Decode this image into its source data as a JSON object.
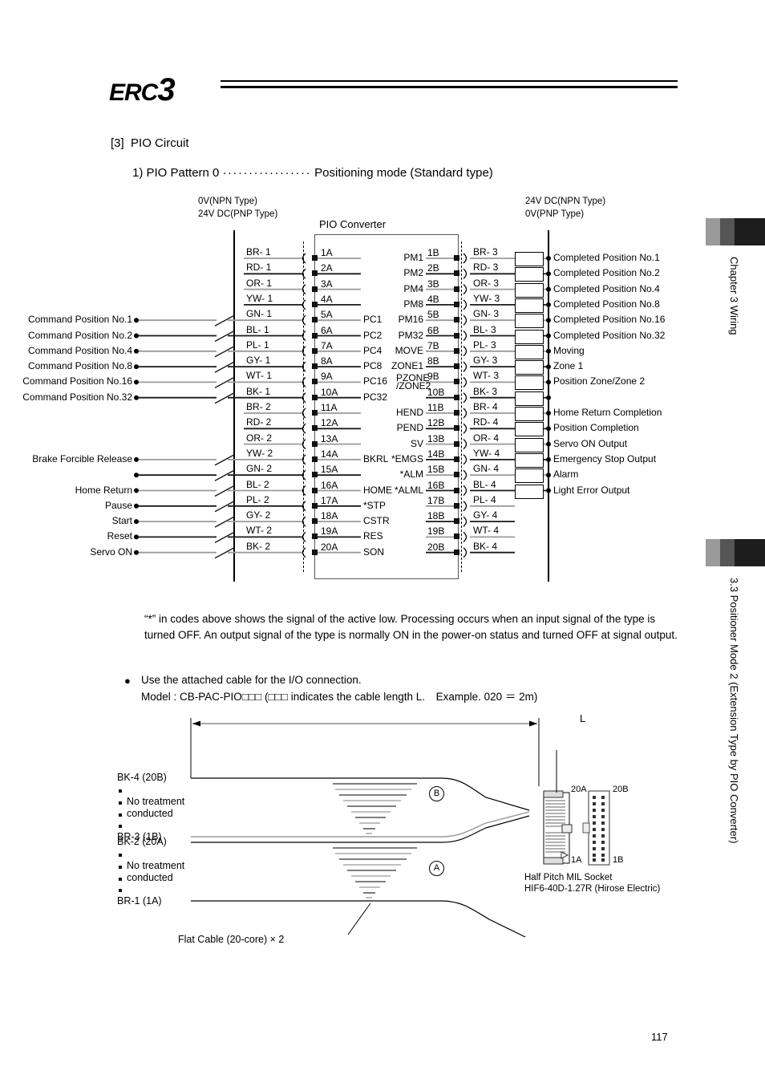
{
  "document": {
    "logo_erc": "ERC",
    "logo_3": "3",
    "page_number": "117"
  },
  "section": {
    "number": "[3]",
    "title": "PIO Circuit",
    "subsection_prefix": "1) PIO Pattern 0",
    "dot_leader": "·················",
    "subsection_suffix": "Positioning mode (Standard type)"
  },
  "sidebar": {
    "chapter_tab": "Chapter 3 Wiring",
    "section_tab": "3.3 Positioner Mode 2 (Extension Type by PIO Converter)"
  },
  "diagram": {
    "converter_title": "PIO Converter",
    "left_supply_line1": "0V(NPN Type)",
    "left_supply_line2": "24V DC(PNP Type)",
    "right_supply_line1": "24V DC(NPN Type)",
    "right_supply_line2": "0V(PNP Type)",
    "input_rows": [
      {
        "pin": "1A",
        "wire": "BR- 1",
        "signal": "",
        "io": "",
        "switch": false,
        "gray": true
      },
      {
        "pin": "2A",
        "wire": "RD- 1",
        "signal": "",
        "io": "",
        "switch": false,
        "gray": false
      },
      {
        "pin": "3A",
        "wire": "OR- 1",
        "signal": "",
        "io": "",
        "switch": false,
        "gray": true
      },
      {
        "pin": "4A",
        "wire": "YW- 1",
        "signal": "",
        "io": "",
        "switch": false,
        "gray": false
      },
      {
        "pin": "5A",
        "wire": "GN- 1",
        "signal": "PC1",
        "io": "Command Position No.1",
        "switch": true,
        "gray": true
      },
      {
        "pin": "6A",
        "wire": "BL- 1",
        "signal": "PC2",
        "io": "Command Position No.2",
        "switch": true,
        "gray": false
      },
      {
        "pin": "7A",
        "wire": "PL- 1",
        "signal": "PC4",
        "io": "Command Position No.4",
        "switch": true,
        "gray": true
      },
      {
        "pin": "8A",
        "wire": "GY- 1",
        "signal": "PC8",
        "io": "Command Position No.8",
        "switch": true,
        "gray": false
      },
      {
        "pin": "9A",
        "wire": "WT- 1",
        "signal": "PC16",
        "io": "Command Position No.16",
        "switch": true,
        "gray": true
      },
      {
        "pin": "10A",
        "wire": "BK- 1",
        "signal": "PC32",
        "io": "Command Position No.32",
        "switch": true,
        "gray": false
      },
      {
        "pin": "11A",
        "wire": "BR- 2",
        "signal": "",
        "io": "",
        "switch": false,
        "gray": true
      },
      {
        "pin": "12A",
        "wire": "RD- 2",
        "signal": "",
        "io": "",
        "switch": false,
        "gray": false
      },
      {
        "pin": "13A",
        "wire": "OR- 2",
        "signal": "",
        "io": "",
        "switch": false,
        "gray": true
      },
      {
        "pin": "14A",
        "wire": "YW- 2",
        "signal": "BKRL",
        "io": "Brake Forcible Release",
        "switch": true,
        "gray": true
      },
      {
        "pin": "15A",
        "wire": "GN- 2",
        "signal": "",
        "io": "",
        "switch": true,
        "gray": false
      },
      {
        "pin": "16A",
        "wire": "BL- 2",
        "signal": "HOME",
        "io": "Home Return",
        "switch": true,
        "gray": true
      },
      {
        "pin": "17A",
        "wire": "PL- 2",
        "signal": "*STP",
        "io": "Pause",
        "switch": true,
        "gray": false
      },
      {
        "pin": "18A",
        "wire": "GY- 2",
        "signal": "CSTR",
        "io": "Start",
        "switch": true,
        "gray": true
      },
      {
        "pin": "19A",
        "wire": "WT- 2",
        "signal": "RES",
        "io": "Reset",
        "switch": true,
        "gray": false
      },
      {
        "pin": "20A",
        "wire": "BK- 2",
        "signal": "SON",
        "io": "Servo ON",
        "switch": true,
        "gray": true
      }
    ],
    "output_rows": [
      {
        "pin": "1B",
        "wire": "BR- 3",
        "signal": "PM1",
        "io": "Completed Position No.1",
        "relay": true,
        "gray": true
      },
      {
        "pin": "2B",
        "wire": "RD- 3",
        "signal": "PM2",
        "io": "Completed Position No.2",
        "relay": true,
        "gray": false
      },
      {
        "pin": "3B",
        "wire": "OR- 3",
        "signal": "PM4",
        "io": "Completed Position No.4",
        "relay": true,
        "gray": true
      },
      {
        "pin": "4B",
        "wire": "YW- 3",
        "signal": "PM8",
        "io": "Completed Position No.8",
        "relay": true,
        "gray": false
      },
      {
        "pin": "5B",
        "wire": "GN- 3",
        "signal": "PM16",
        "io": "Completed Position No.16",
        "relay": true,
        "gray": true
      },
      {
        "pin": "6B",
        "wire": "BL- 3",
        "signal": "PM32",
        "io": "Completed Position No.32",
        "relay": true,
        "gray": false
      },
      {
        "pin": "7B",
        "wire": "PL- 3",
        "signal": "MOVE",
        "io": "Moving",
        "relay": true,
        "gray": true
      },
      {
        "pin": "8B",
        "wire": "GY- 3",
        "signal": "ZONE1",
        "io": "Zone 1",
        "relay": true,
        "gray": false
      },
      {
        "pin": "9B",
        "wire": "WT- 3",
        "signal": "PZONE\n/ZONE2",
        "io": "Position Zone/Zone 2",
        "relay": true,
        "gray": true
      },
      {
        "pin": "10B",
        "wire": "BK- 3",
        "signal": "",
        "io": "",
        "relay": true,
        "gray": false
      },
      {
        "pin": "11B",
        "wire": "BR- 4",
        "signal": "HEND",
        "io": "Home Return Completion",
        "relay": true,
        "gray": true
      },
      {
        "pin": "12B",
        "wire": "RD- 4",
        "signal": "PEND",
        "io": "Position Completion",
        "relay": true,
        "gray": false
      },
      {
        "pin": "13B",
        "wire": "OR- 4",
        "signal": "SV",
        "io": "Servo ON Output",
        "relay": true,
        "gray": true
      },
      {
        "pin": "14B",
        "wire": "YW- 4",
        "signal": "*EMGS",
        "io": "Emergency Stop Output",
        "relay": true,
        "gray": false
      },
      {
        "pin": "15B",
        "wire": "GN- 4",
        "signal": "*ALM",
        "io": "Alarm",
        "relay": true,
        "gray": true
      },
      {
        "pin": "16B",
        "wire": "BL- 4",
        "signal": "*ALML",
        "io": "Light Error Output",
        "relay": true,
        "gray": false
      },
      {
        "pin": "17B",
        "wire": "PL- 4",
        "signal": "",
        "io": "",
        "relay": false,
        "gray": true
      },
      {
        "pin": "18B",
        "wire": "GY- 4",
        "signal": "",
        "io": "",
        "relay": false,
        "gray": false
      },
      {
        "pin": "19B",
        "wire": "WT- 4",
        "signal": "",
        "io": "",
        "relay": false,
        "gray": true
      },
      {
        "pin": "20B",
        "wire": "BK- 4",
        "signal": "",
        "io": "",
        "relay": false,
        "gray": false
      }
    ],
    "zone9b_line1": "PZONE",
    "zone9b_line2": "/ZONE2"
  },
  "notes": {
    "asterisk_note": "“*” in codes above shows the signal of the active low. Processing occurs when an input signal of the type is turned OFF. An output signal of the type is normally ON in the power-on status and turned OFF at signal output.",
    "bullet_symbol": "●",
    "cable_note_line1": "Use the attached cable for the I/O connection.",
    "cable_note_line2": "Model : CB-PAC-PIO□□□ (□□□ indicates the cable length L. Example. 020 ＝ 2m)"
  },
  "cable_diagram": {
    "length_label": "L",
    "upper_top": "BK-4 (20B)",
    "upper_mid1": "No treatment",
    "upper_mid2": "conducted",
    "upper_bottom": "BR-3 (1B)",
    "lower_top": "BK-2 (20A)",
    "lower_mid1": "No treatment",
    "lower_mid2": "conducted",
    "lower_bottom": "BR-1 (1A)",
    "group_b": "B",
    "group_a": "A",
    "flat_cable_caption": "Flat Cable (20-core) × 2",
    "connector_20a": "20A",
    "connector_20b": "20B",
    "connector_1a": "1A",
    "connector_1b": "1B",
    "socket_line1": "Half Pitch MIL Socket",
    "socket_line2": "HIF6-40D-1.27R (Hirose Electric)"
  }
}
